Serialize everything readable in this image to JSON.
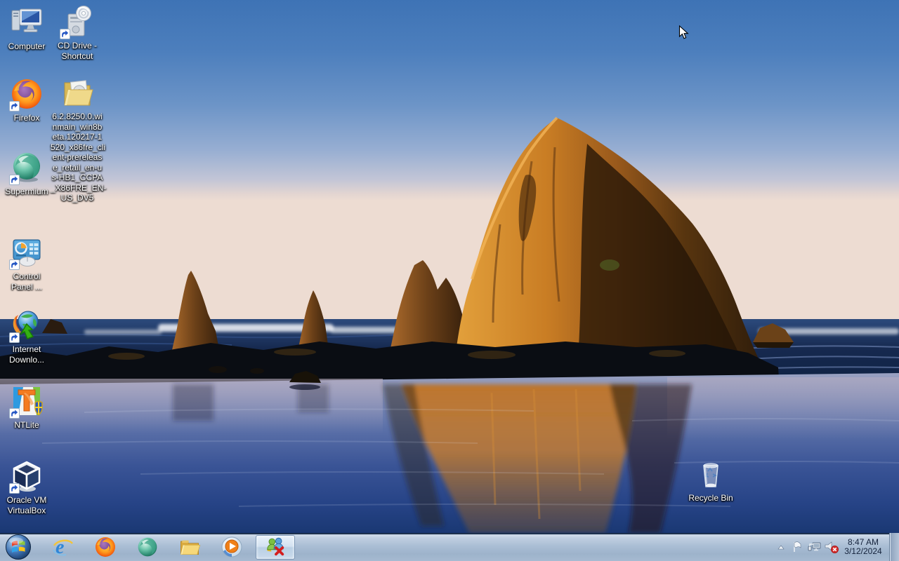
{
  "desktop": {
    "icons": [
      {
        "name": "computer",
        "label": "Computer"
      },
      {
        "name": "cd-drive-shortcut",
        "label": [
          "CD Drive -",
          "Shortcut"
        ]
      },
      {
        "name": "firefox",
        "label": "Firefox"
      },
      {
        "name": "windows-build-folder",
        "label": [
          "6.2.8250.0.wi",
          "nmain_win8b",
          "eta.120217-1",
          "520_x86fre_cli",
          "ent-prereleas",
          "e_retail_en-u",
          "s-HB1_CCPA",
          "_X86FRE_EN-",
          "US_DV5"
        ]
      },
      {
        "name": "supermium",
        "label": "Supermium"
      },
      {
        "name": "control-panel",
        "label": [
          "Control",
          "Panel ..."
        ]
      },
      {
        "name": "internet-download-manager",
        "label": [
          "Internet",
          "Downlo..."
        ]
      },
      {
        "name": "ntlite",
        "label": "NTLite"
      },
      {
        "name": "oracle-vm-virtualbox",
        "label": [
          "Oracle VM",
          "VirtualBox"
        ]
      },
      {
        "name": "recycle-bin",
        "label": "Recycle Bin"
      }
    ]
  },
  "taskbar": {
    "apps": [
      {
        "icon": "start-orb"
      },
      {
        "icon": "internet-explorer-icon"
      },
      {
        "icon": "firefox-icon"
      },
      {
        "icon": "supermium-icon"
      },
      {
        "icon": "windows-explorer-icon"
      },
      {
        "icon": "windows-media-player-icon"
      },
      {
        "icon": "messenger-offline-icon",
        "state": "active"
      }
    ],
    "tray": {
      "icons": [
        "show-hidden-icons",
        "action-center-flag",
        "network-status",
        "volume-muted"
      ],
      "time": "8:47 AM",
      "date": "3/12/2024"
    }
  },
  "colors": {
    "sky_top": "#3e73b5",
    "sky_horizon": "#eddcd2",
    "sea_dark": "#12264c",
    "sand_deep": "#1a3873",
    "rock_lit": "#e09a33",
    "rock_shadow": "#2e1c0a",
    "taskbar": "#a9bdd3"
  }
}
